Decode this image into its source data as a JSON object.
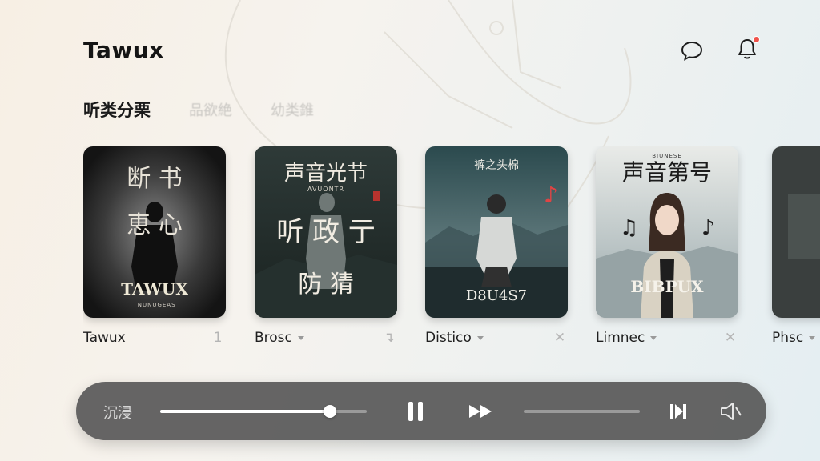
{
  "app": {
    "title": "Tawux"
  },
  "header": {
    "chat_icon": "chat-bubble-icon",
    "bell_icon": "bell-icon",
    "has_notification": true
  },
  "tabs": [
    {
      "label": "听类分栗",
      "active": true
    },
    {
      "label": "品欲絶",
      "active": false
    },
    {
      "label": "幼类錐",
      "active": false
    }
  ],
  "cards": [
    {
      "name": "Tawux",
      "action": "1",
      "cover_top": "断 书",
      "cover_mid": "恵 心",
      "cover_bottom": "TAWUX",
      "cover_small": "TNUNUGEAS"
    },
    {
      "name": "Brosc",
      "action": "↴",
      "cover_top": "声音光节",
      "cover_mid": "听 政 亍",
      "cover_bottom": "防 猜",
      "cover_small": "AVUONTR"
    },
    {
      "name": "Distico",
      "action": "✕",
      "cover_top": "裤之头棉",
      "cover_mid": "",
      "cover_bottom": "D8U4S7",
      "cover_small": ""
    },
    {
      "name": "Limnec",
      "action": "✕",
      "cover_top": "声音第号",
      "cover_mid": "",
      "cover_bottom": "BIBPUX",
      "cover_small": "BIUNESE"
    },
    {
      "name": "Phsc",
      "action": "",
      "cover_top": "",
      "cover_mid": "",
      "cover_bottom": "",
      "cover_small": ""
    }
  ],
  "player": {
    "mode_label": "沉浸",
    "progress": 0.82,
    "volume": 0.0,
    "icons": [
      "pause-icon",
      "fast-forward-icon",
      "skip-icon",
      "speaker-icon"
    ]
  },
  "colors": {
    "accent_badge": "#f0534b",
    "player_bg": "#585858"
  }
}
